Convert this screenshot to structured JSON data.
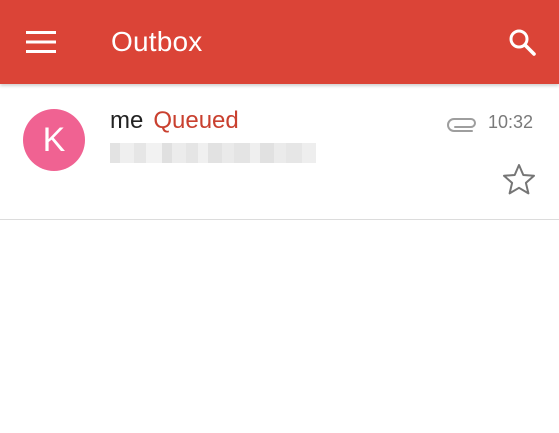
{
  "app_bar": {
    "title": "Outbox",
    "background_color": "#db4437",
    "menu_icon": "hamburger-menu-icon",
    "search_icon": "search-icon"
  },
  "messages": [
    {
      "avatar_letter": "K",
      "avatar_color": "#f06292",
      "sender": "me",
      "status": "Queued",
      "status_color": "#c9402f",
      "snippet_state": "blurred/redacted",
      "has_attachment": true,
      "attachment_icon": "paperclip-icon",
      "time": "10:32",
      "starred": false,
      "star_icon": "star-outline-icon"
    }
  ]
}
